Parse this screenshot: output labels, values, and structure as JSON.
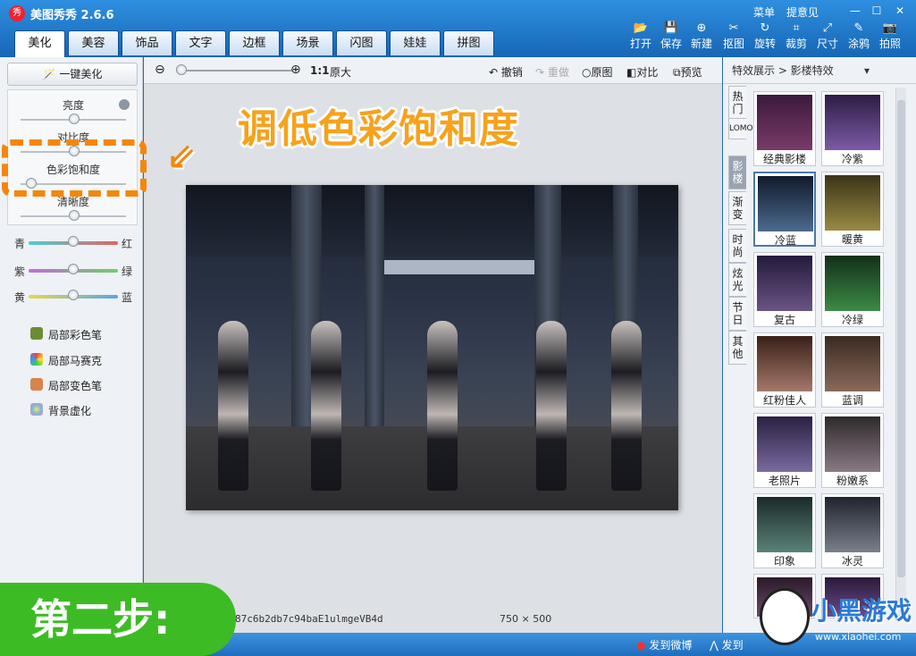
{
  "app": {
    "title": "美图秀秀 2.6.6",
    "logo_text": "秀"
  },
  "window": {
    "menu": "菜单",
    "feedback": "提意见"
  },
  "tabs": [
    "美化",
    "美容",
    "饰品",
    "文字",
    "边框",
    "场景",
    "闪图",
    "娃娃",
    "拼图"
  ],
  "toolbar": [
    {
      "label": "打开",
      "icon": "open-icon"
    },
    {
      "label": "保存",
      "icon": "save-icon"
    },
    {
      "label": "新建",
      "icon": "new-icon"
    },
    {
      "label": "抠图",
      "icon": "cutout-icon"
    },
    {
      "label": "旋转",
      "icon": "rotate-icon"
    },
    {
      "label": "裁剪",
      "icon": "crop-icon"
    },
    {
      "label": "尺寸",
      "icon": "resize-icon"
    },
    {
      "label": "涂鸦",
      "icon": "doodle-icon"
    },
    {
      "label": "拍照",
      "icon": "camera-icon"
    }
  ],
  "left": {
    "one_key": "一键美化",
    "brightness": "亮度",
    "contrast": "对比度",
    "saturation": "色彩饱和度",
    "sharpness": "清晰度",
    "color_rows": [
      {
        "left": "青",
        "right": "红"
      },
      {
        "left": "紫",
        "right": "绿"
      },
      {
        "left": "黄",
        "right": "蓝"
      }
    ],
    "tools": [
      "局部彩色笔",
      "局部马赛克",
      "局部变色笔",
      "背景虚化"
    ]
  },
  "canvas": {
    "zoom_label": "1:1",
    "original_size": "原大",
    "undo": "撤销",
    "redo": "重做",
    "original": "原图",
    "compare": "对比",
    "preview": "预览",
    "filename": "87c6b2db7c94baE1ulmgeVB4d",
    "dimensions": "750 × 500"
  },
  "right": {
    "header": "特效展示 > 影楼特效",
    "vtabs": [
      "热门",
      "LOMO",
      "影楼",
      "渐变",
      "时尚",
      "炫光",
      "节日",
      "其他"
    ],
    "effects": [
      "经典影楼",
      "冷紫",
      "冷蓝",
      "暖黄",
      "复古",
      "冷绿",
      "红粉佳人",
      "蓝调",
      "老照片",
      "粉嫩系",
      "印象",
      "冰灵"
    ]
  },
  "bottom": {
    "weibo": "发到微博",
    "send": "发到"
  },
  "annotation": {
    "callout": "调低色彩饱和度",
    "step": "第二步:"
  },
  "watermark": {
    "text": "小黑游戏",
    "url": "www.xiaohei.com"
  }
}
